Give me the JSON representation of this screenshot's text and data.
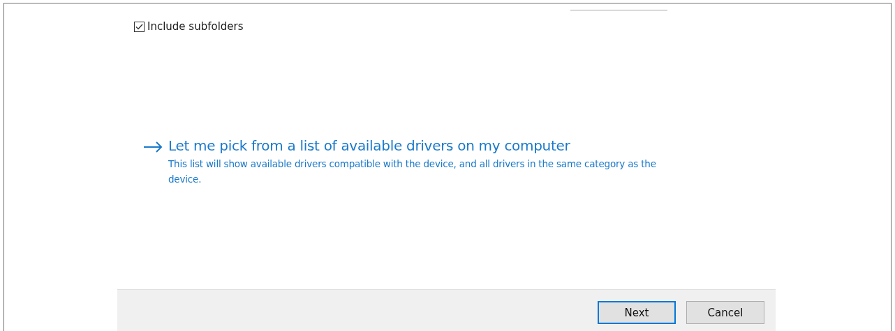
{
  "include_subfolders": {
    "label": "Include subfolders",
    "checked": true
  },
  "pick_option": {
    "title": "Let me pick from a list of available drivers on my computer",
    "description": "This list will show available drivers compatible with the device, and all drivers in the same category as the device."
  },
  "buttons": [
    {
      "label": "Next",
      "selected": true
    },
    {
      "label": "Cancel",
      "selected": false
    }
  ]
}
